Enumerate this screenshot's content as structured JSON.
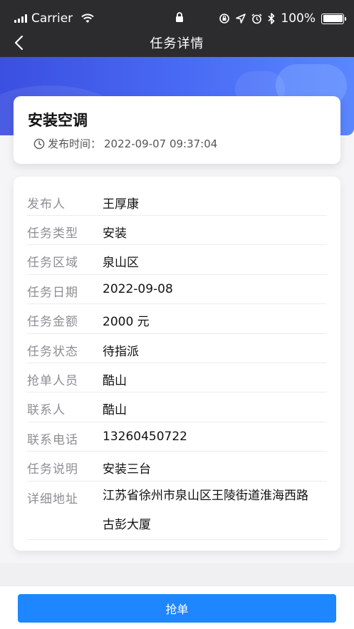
{
  "status_bar": {
    "carrier": "Carrier",
    "battery": "100%"
  },
  "nav": {
    "title": "任务详情",
    "back_icon": "chevron-left-icon"
  },
  "task": {
    "title": "安装空调",
    "publish_label": "发布时间：",
    "publish_time": "2022-09-07 09:37:04"
  },
  "details": [
    {
      "label": "发布人",
      "value": "王厚康"
    },
    {
      "label": "任务类型",
      "value": "安装"
    },
    {
      "label": "任务区域",
      "value": "泉山区"
    },
    {
      "label": "任务日期",
      "value": "2022-09-08"
    },
    {
      "label": "任务金额",
      "value": "2000 元"
    },
    {
      "label": "任务状态",
      "value": "待指派"
    },
    {
      "label": "抢单人员",
      "value": "酷山"
    },
    {
      "label": "联系人",
      "value": "酷山"
    },
    {
      "label": "联系电话",
      "value": "13260450722"
    },
    {
      "label": "任务说明",
      "value": "安装三台"
    },
    {
      "label": "详细地址",
      "value": "江苏省徐州市泉山区王陵街道淮海西路古彭大厦"
    }
  ],
  "actions": {
    "grab_label": "抢单"
  },
  "colors": {
    "nav_bg": "#2c2c2e",
    "banner": "#4a6cf5",
    "primary_button": "#1e86ff",
    "label_gray": "#8e8e93"
  }
}
